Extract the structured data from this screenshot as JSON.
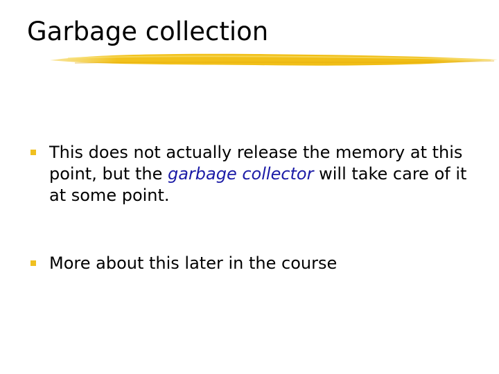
{
  "slide": {
    "title": "Garbage collection",
    "accent_color": "#f0c020",
    "emphasis_color": "#1a1aa6"
  },
  "bullets": [
    {
      "text_before": "This does not actually release the memory at this point, but the ",
      "emphasis": "garbage collector",
      "text_after": " will take care of it at some point."
    },
    {
      "text": "More about this later in the course"
    }
  ]
}
